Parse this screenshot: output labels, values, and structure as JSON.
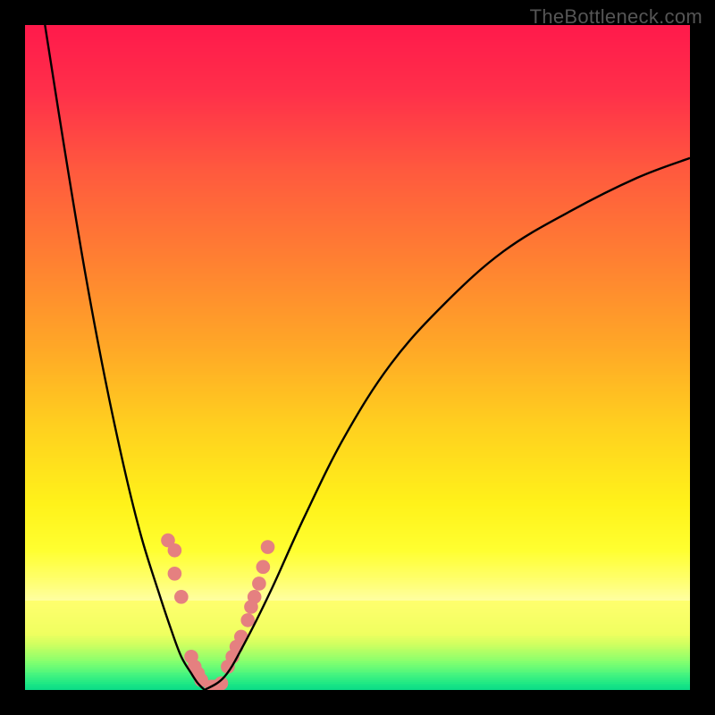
{
  "watermark": "TheBottleneck.com",
  "chart_data": {
    "type": "line",
    "title": "",
    "xlabel": "",
    "ylabel": "",
    "xlim": [
      0,
      100
    ],
    "ylim": [
      0,
      100
    ],
    "series": [
      {
        "name": "bottleneck-curve-left",
        "x": [
          3,
          6,
          9,
          12,
          15,
          17.5,
          20,
          22,
          23.5,
          25,
          26,
          27
        ],
        "y": [
          100,
          81,
          63,
          47,
          33,
          23,
          15,
          9,
          5,
          2.5,
          1,
          0
        ]
      },
      {
        "name": "bottleneck-curve-right",
        "x": [
          27,
          30,
          33,
          37,
          42,
          48,
          55,
          63,
          72,
          82,
          92,
          100
        ],
        "y": [
          0,
          2,
          7,
          15,
          26,
          38,
          49,
          58,
          66,
          72,
          77,
          80
        ]
      },
      {
        "name": "scatter-points",
        "x": [
          21.5,
          22.5,
          22.5,
          23.5,
          25.0,
          25.5,
          26.0,
          26.5,
          28.0,
          28.5,
          29.0,
          29.5,
          30.5,
          31.2,
          31.8,
          32.5,
          33.5,
          34.0,
          34.5,
          35.2,
          35.8,
          36.5
        ],
        "y": [
          22.5,
          21.0,
          17.5,
          14.0,
          5.0,
          3.5,
          2.5,
          1.5,
          0.5,
          0.5,
          0.5,
          1.0,
          3.5,
          5.0,
          6.5,
          8.0,
          10.5,
          12.5,
          14.0,
          16.0,
          18.5,
          21.5
        ]
      }
    ],
    "gradient": {
      "stops": [
        {
          "pos": 0.0,
          "color": "#ff1a4b"
        },
        {
          "pos": 0.1,
          "color": "#ff2f4a"
        },
        {
          "pos": 0.22,
          "color": "#ff5a3e"
        },
        {
          "pos": 0.35,
          "color": "#ff7f32"
        },
        {
          "pos": 0.48,
          "color": "#ffa627"
        },
        {
          "pos": 0.6,
          "color": "#ffcf1f"
        },
        {
          "pos": 0.72,
          "color": "#fff21a"
        },
        {
          "pos": 0.79,
          "color": "#ffff30"
        },
        {
          "pos": 0.835,
          "color": "#ffff6e"
        },
        {
          "pos": 0.866,
          "color": "#ffffa3"
        },
        {
          "pos": 0.866,
          "color": "#ffff6e"
        },
        {
          "pos": 0.915,
          "color": "#f0ff60"
        },
        {
          "pos": 0.93,
          "color": "#d2ff60"
        },
        {
          "pos": 0.945,
          "color": "#aaff66"
        },
        {
          "pos": 0.96,
          "color": "#7dff70"
        },
        {
          "pos": 0.975,
          "color": "#4cf57e"
        },
        {
          "pos": 0.99,
          "color": "#1de885"
        },
        {
          "pos": 1.0,
          "color": "#0bdc87"
        }
      ]
    },
    "scatter_color": "#e58080",
    "scatter_radius_pct": 1.05,
    "curve_color": "#000000",
    "curve_width": 2.4
  }
}
